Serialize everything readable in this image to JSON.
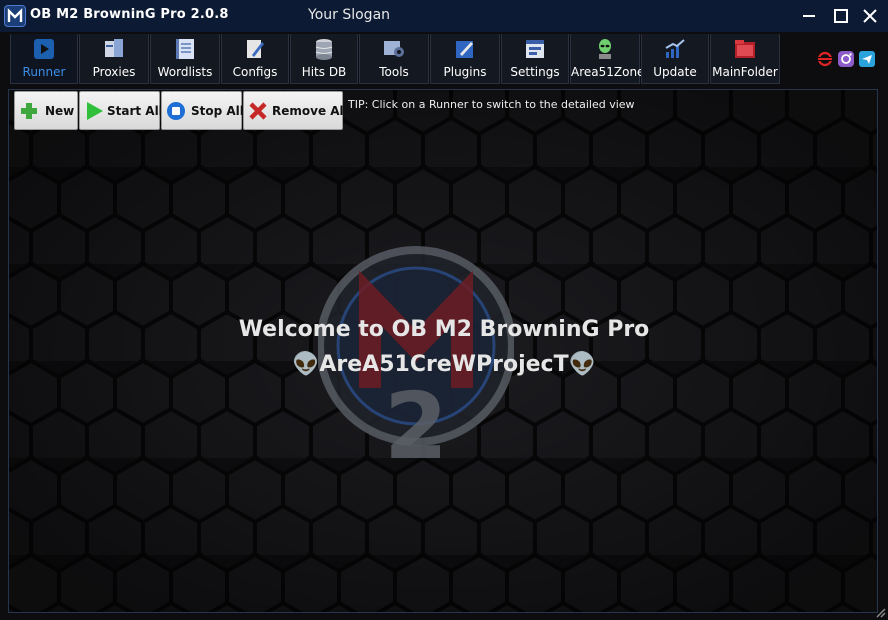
{
  "window": {
    "title": "OB M2 BrowninG Pro  2.0.8",
    "slogan": "Your Slogan",
    "controls": [
      "minimize-icon",
      "maximize-icon",
      "close-icon"
    ]
  },
  "tabs": [
    {
      "label": "Runner",
      "icon": "play-icon",
      "active": true
    },
    {
      "label": "Proxies",
      "icon": "servers-icon",
      "active": false
    },
    {
      "label": "Wordlists",
      "icon": "book-icon",
      "active": false
    },
    {
      "label": "Configs",
      "icon": "pencil-doc-icon",
      "active": false
    },
    {
      "label": "Hits DB",
      "icon": "database-icon",
      "active": false
    },
    {
      "label": "Tools",
      "icon": "tools-icon",
      "active": false
    },
    {
      "label": "Plugins",
      "icon": "plugin-edit-icon",
      "active": false
    },
    {
      "label": "Settings",
      "icon": "settings-window-icon",
      "active": false
    },
    {
      "label": "Area51Zone",
      "icon": "alien-icon",
      "active": false
    },
    {
      "label": "Update",
      "icon": "chart-up-icon",
      "active": false
    },
    {
      "label": "MainFolder",
      "icon": "folder-icon",
      "active": false
    }
  ],
  "social_icons": [
    "sync-icon",
    "instagram-icon",
    "telegram-icon"
  ],
  "actions": {
    "new": "New",
    "start_all": "Start All",
    "stop_all": "Stop All",
    "remove_all": "Remove All"
  },
  "tip": "TIP: Click on a Runner to switch to the detailed view",
  "welcome": {
    "line1": "Welcome to OB M2 BrowninG Pro",
    "line2": "👽AreA51CreWProjecT👽"
  },
  "colors": {
    "titlebar": "#0c1a33",
    "active_tab": "#3d8ee6",
    "background": "#111114"
  }
}
